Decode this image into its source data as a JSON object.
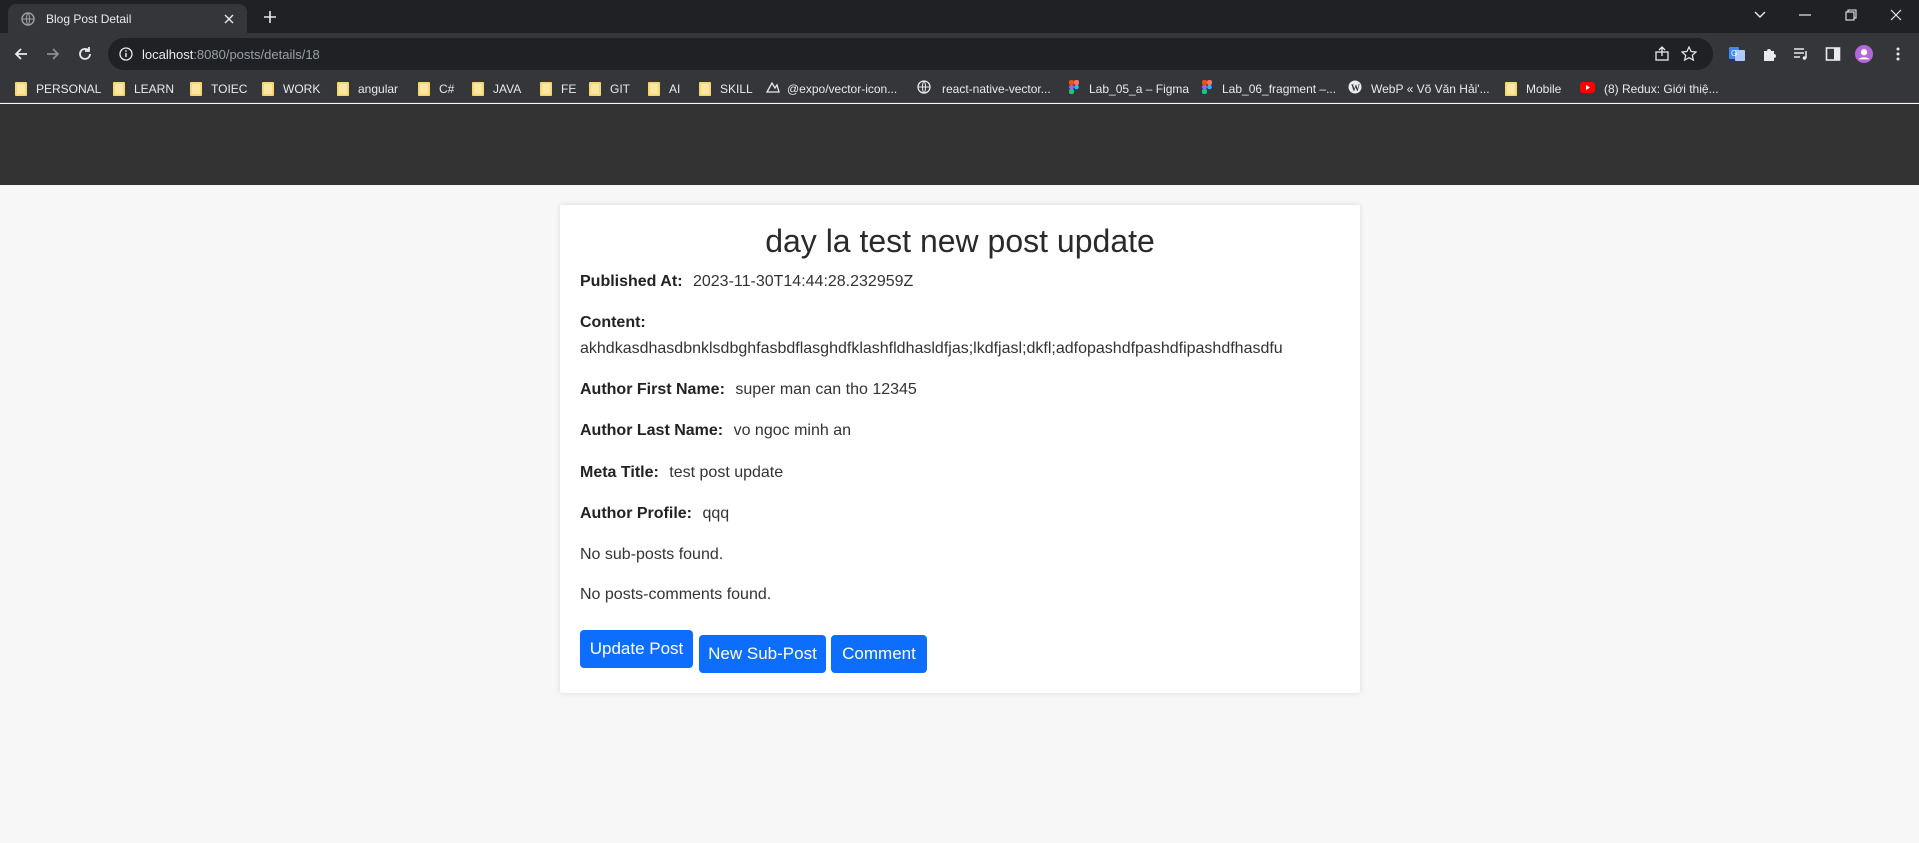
{
  "browser": {
    "tab_title": "Blog Post Detail",
    "url_host": "localhost",
    "url_path": ":8080/posts/details/18",
    "bookmarks": [
      {
        "label": "PERSONAL",
        "icon": "folder-icon"
      },
      {
        "label": "LEARN",
        "icon": "folder-icon"
      },
      {
        "label": "TOIEC",
        "icon": "folder-icon"
      },
      {
        "label": "WORK",
        "icon": "folder-icon"
      },
      {
        "label": "angular",
        "icon": "folder-icon"
      },
      {
        "label": "C#",
        "icon": "folder-icon"
      },
      {
        "label": "JAVA",
        "icon": "folder-icon"
      },
      {
        "label": "FE",
        "icon": "folder-icon"
      },
      {
        "label": "GIT",
        "icon": "folder-icon"
      },
      {
        "label": "AI",
        "icon": "folder-icon"
      },
      {
        "label": "SKILL",
        "icon": "folder-icon"
      },
      {
        "label": "@expo/vector-icon...",
        "icon": "expo-icon"
      },
      {
        "label": "react-native-vector...",
        "icon": "globe-icon"
      },
      {
        "label": "Lab_05_a – Figma",
        "icon": "figma-icon"
      },
      {
        "label": "Lab_06_fragment –...",
        "icon": "figma-icon"
      },
      {
        "label": "WebP « Võ Văn Hải'...",
        "icon": "wordpress-icon"
      },
      {
        "label": "Mobile",
        "icon": "folder-icon"
      },
      {
        "label": "(8) Redux: Giới thiệ...",
        "icon": "youtube-icon"
      }
    ]
  },
  "post": {
    "title": "day la test new post update",
    "published_label": "Published At:",
    "published_value": "2023-11-30T14:44:28.232959Z",
    "content_label": "Content:",
    "content_value": "akhdkasdhasdbnklsdbghfasbdflasghdfklashfldhasldfjas;lkdfjasl;dkfl;adfopashdfpashdfipashdfhasdfu",
    "first_name_label": "Author First Name:",
    "first_name_value": "super man can tho 12345",
    "last_name_label": "Author Last Name:",
    "last_name_value": "vo ngoc minh an",
    "meta_title_label": "Meta Title:",
    "meta_title_value": "test post update",
    "profile_label": "Author Profile:",
    "profile_value": "qqq",
    "no_subposts": "No sub-posts found.",
    "no_comments": "No posts-comments found."
  },
  "actions": {
    "update_label": "Update Post",
    "new_subpost_label": "New Sub-Post",
    "comment_label": "Comment"
  },
  "colors": {
    "header_bg": "#333333",
    "primary_button": "#0d6efd",
    "page_bg": "#f7f7f7"
  }
}
